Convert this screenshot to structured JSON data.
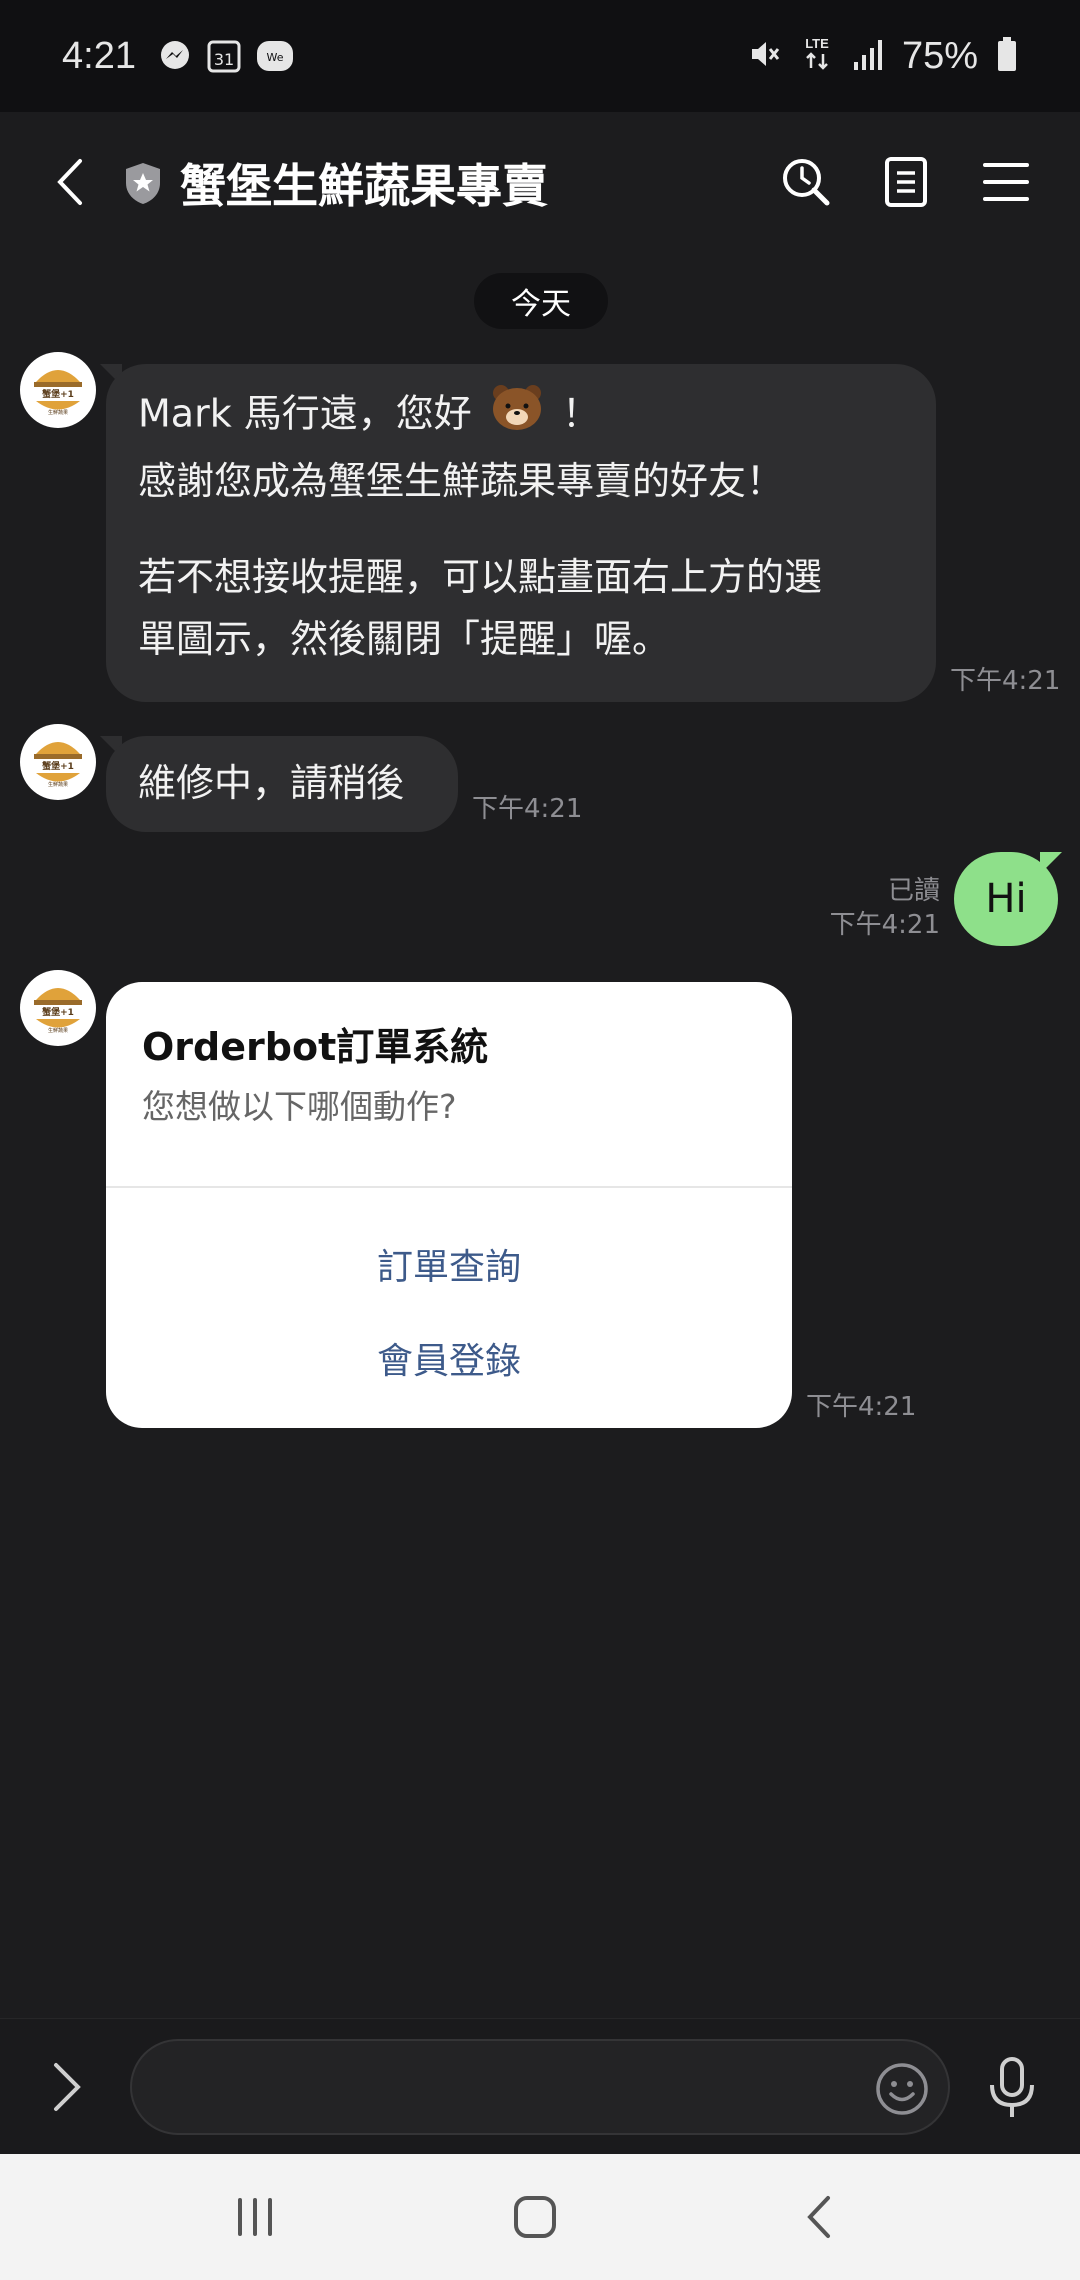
{
  "status_bar": {
    "time": "4:21",
    "icons": [
      "messenger-icon",
      "calendar-icon",
      "wecr-icon"
    ],
    "calendar_day": "31",
    "wecr_label": "We",
    "network": "LTE",
    "battery_percent": "75%",
    "right_icons": [
      "mute-icon",
      "lte-icon",
      "signal-icon",
      "battery-icon"
    ]
  },
  "header": {
    "title": "蟹堡生鮮蔬果專賣",
    "icons": [
      "back-icon",
      "official-badge-icon",
      "search-history-icon",
      "notes-icon",
      "menu-icon"
    ]
  },
  "date_chip": "今天",
  "messages": {
    "welcome": {
      "line1_a": "Mark 馬行遠，您好",
      "line1_b": "！",
      "line2": "感謝您成為蟹堡生鮮蔬果專賣的好友！",
      "line3": "若不想接收提醒，可以點畫面右上方的選",
      "line4": "單圖示，然後關閉「提醒」喔。",
      "time": "下午4:21",
      "emoji_icon": "brown-bear-emoji-icon"
    },
    "maintenance": {
      "text": "維修中，請稍後",
      "time": "下午4:21"
    },
    "outgoing": {
      "text": "Hi",
      "read": "已讀",
      "time": "下午4:21"
    },
    "card": {
      "title": "Orderbot訂單系統",
      "subtitle": "您想做以下哪個動作?",
      "actions": [
        "訂單查詢",
        "會員登錄"
      ],
      "time": "下午4:21"
    }
  },
  "avatar": {
    "brand_text": "蟹堡+1",
    "sub_text": "生鮮蔬果"
  },
  "input_bar": {
    "placeholder": "",
    "icons": [
      "expand-icon",
      "emoji-icon",
      "microphone-icon"
    ]
  },
  "nav_bar": {
    "icons": [
      "recent-apps-icon",
      "home-icon",
      "back-nav-icon"
    ]
  },
  "colors": {
    "background": "#1c1c1e",
    "incoming_bubble": "#2e2e30",
    "outgoing_bubble": "#8ee08a",
    "card_action": "#3d5a8a"
  }
}
